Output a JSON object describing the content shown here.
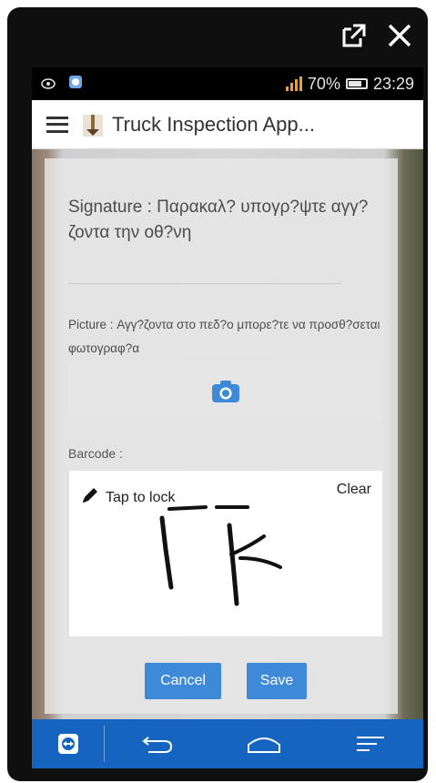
{
  "status_bar": {
    "battery": "70%",
    "time": "23:29"
  },
  "app": {
    "title": "Truck Inspection App..."
  },
  "form": {
    "signature_label": "Signature : Παρακαλ? υπογρ?ψτε αγγ?ζοντα     την οθ?νη",
    "picture_label": "Picture : Αγγ?ζοντα     στο πεδ?ο μπορε?τε να προσθ?σεται φωτογραφ?α",
    "barcode_label": "Barcode :",
    "signature_pad": {
      "tap_to_lock": "Tap to lock",
      "clear": "Clear"
    },
    "cancel_label": "Cancel",
    "save_label": "Save"
  },
  "colors": {
    "accent": "#3f8ad8",
    "navbar": "#1565c0",
    "status_bar": "#000000"
  },
  "icons": {
    "window": [
      "external-open-icon",
      "close-icon"
    ],
    "status": [
      "eye-icon",
      "teamviewer-status-icon",
      "signal-icon",
      "battery-icon"
    ],
    "app": [
      "hamburger-menu-icon",
      "truck-app-logo-icon"
    ],
    "form": [
      "camera-icon",
      "pencil-icon"
    ],
    "nav": [
      "teamviewer-icon",
      "back-icon",
      "home-icon",
      "recent-apps-icon"
    ]
  }
}
